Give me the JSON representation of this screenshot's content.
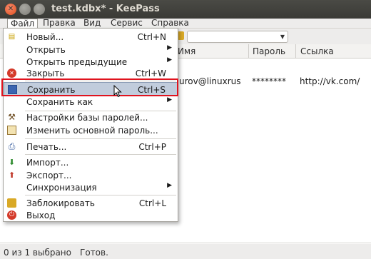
{
  "window": {
    "title": "test.kdbx* - KeePass"
  },
  "menubar": [
    "Файл",
    "Правка",
    "Вид",
    "Сервис",
    "Справка"
  ],
  "columns": [
    "Имя",
    "Пароль",
    "Ссылка"
  ],
  "row": {
    "name": "urov@linuxrus",
    "password": "********",
    "url": "http://vk.com/"
  },
  "file_menu": {
    "new": {
      "label": "Новый...",
      "shortcut": "Ctrl+N"
    },
    "open": {
      "label": "Открыть"
    },
    "open_recent": {
      "label": "Открыть предыдущие"
    },
    "close": {
      "label": "Закрыть",
      "shortcut": "Ctrl+W"
    },
    "save": {
      "label": "Сохранить",
      "shortcut": "Ctrl+S"
    },
    "save_as": {
      "label": "Сохранить как"
    },
    "db_settings": {
      "label": "Настройки базы паролей..."
    },
    "change_master": {
      "label": "Изменить основной пароль..."
    },
    "print": {
      "label": "Печать...",
      "shortcut": "Ctrl+P"
    },
    "import": {
      "label": "Импорт..."
    },
    "export": {
      "label": "Экспорт..."
    },
    "sync": {
      "label": "Синхронизация"
    },
    "lock": {
      "label": "Заблокировать",
      "shortcut": "Ctrl+L"
    },
    "exit": {
      "label": "Выход"
    }
  },
  "statusbar": {
    "count": "0 из 1 выбрано",
    "ready": "Готов."
  },
  "colors": {
    "highlight": "#c1ccdc",
    "annotation": "#e0131e",
    "titlebar": "#3c3b37"
  }
}
